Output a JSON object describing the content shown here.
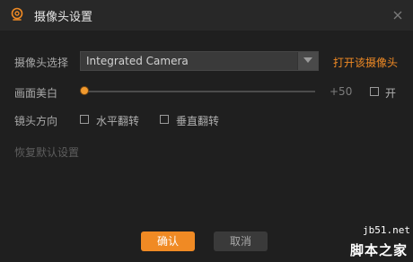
{
  "window": {
    "title": "摄像头设置",
    "close_icon": "close-icon",
    "title_icon": "webcam-icon"
  },
  "camera": {
    "label": "摄像头选择",
    "selected": "Integrated Camera",
    "open_link": "打开该摄像头"
  },
  "beauty": {
    "label": "画面美白",
    "value_text": "+50",
    "level_fraction": 0.0,
    "toggle_label": "开",
    "toggle_checked": false
  },
  "orientation": {
    "label": "镜头方向",
    "horizontal_flip_label": "水平翻转",
    "horizontal_flip_checked": false,
    "vertical_flip_label": "垂直翻转",
    "vertical_flip_checked": false
  },
  "reset_label": "恢复默认设置",
  "buttons": {
    "confirm": "确认",
    "cancel": "取消"
  },
  "watermark": {
    "site": "jb51.net",
    "text": "脚本之家"
  },
  "colors": {
    "accent": "#f08a24",
    "background": "#1f1f1f",
    "titlebar": "#282828"
  }
}
